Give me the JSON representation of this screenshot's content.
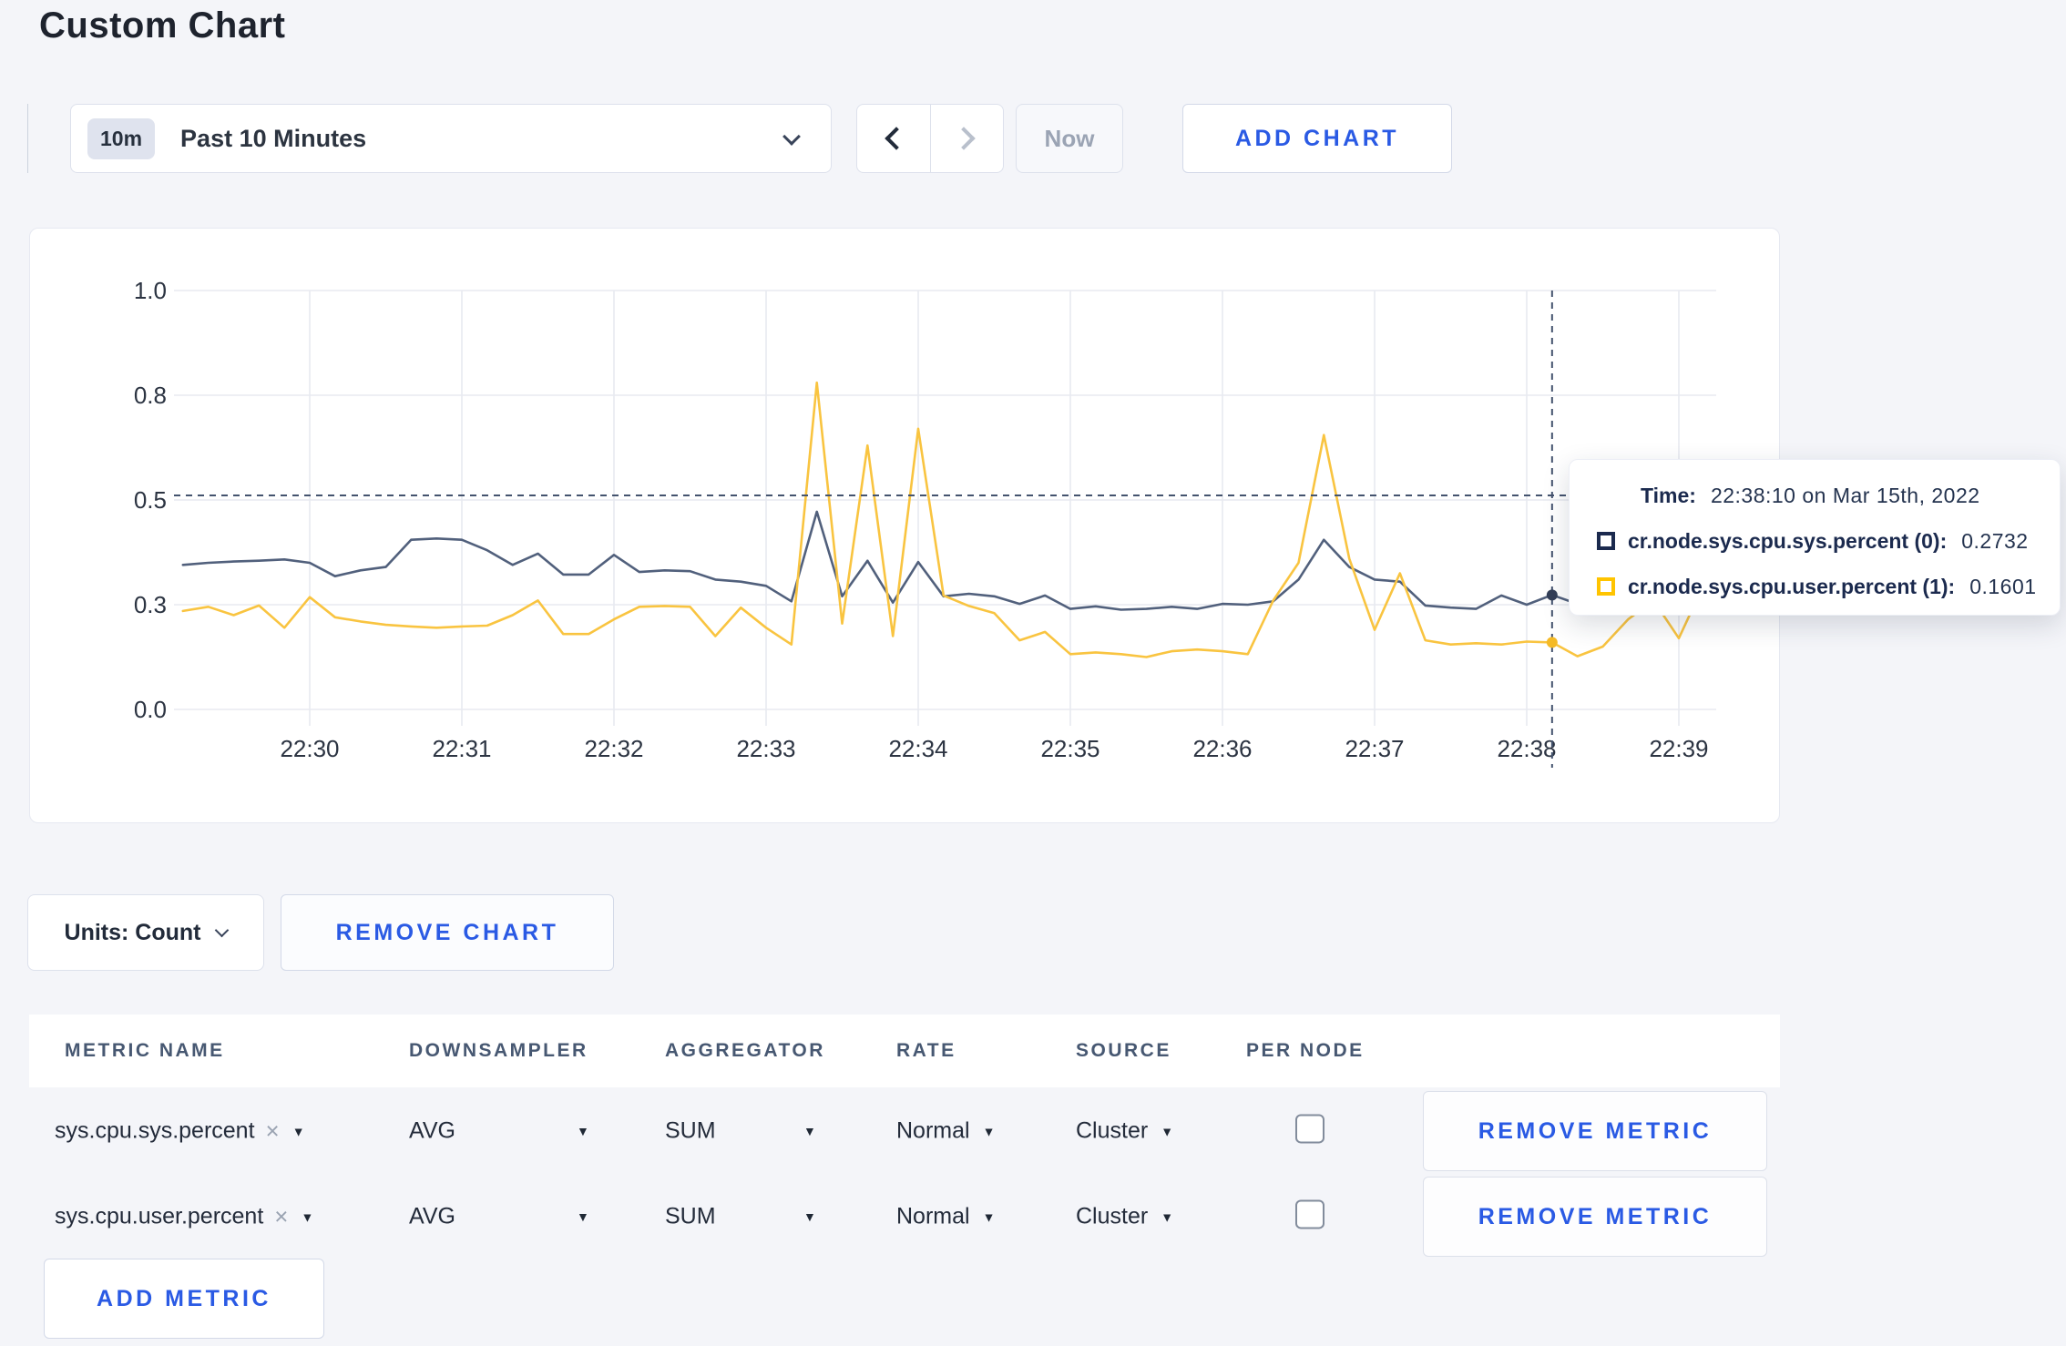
{
  "page": {
    "title": "Custom Chart"
  },
  "toolbar": {
    "timescale_badge": "10m",
    "timescale_label": "Past 10 Minutes",
    "now_label": "Now",
    "add_chart_label": "ADD CHART"
  },
  "chart_data": {
    "type": "line",
    "title": "",
    "xlabel": "",
    "ylabel": "",
    "ylim": [
      0,
      1
    ],
    "grid": true,
    "x_ticks": [
      "22:30",
      "22:31",
      "22:32",
      "22:33",
      "22:34",
      "22:35",
      "22:36",
      "22:37",
      "22:38",
      "22:39"
    ],
    "y_ticks": [
      {
        "label": "0.0",
        "value": 0
      },
      {
        "label": "0.3",
        "value": 0.25
      },
      {
        "label": "0.5",
        "value": 0.5
      },
      {
        "label": "0.8",
        "value": 0.75
      },
      {
        "label": "1.0",
        "value": 1.0
      }
    ],
    "x_start": "22:29:10",
    "x_step_seconds": 10,
    "series": [
      {
        "name": "cr.node.sys.cpu.sys.percent (0)",
        "color": "#51607c",
        "dot_color": "#333f58",
        "value_at_crosshair": 0.2732,
        "values": [
          0.345,
          0.35,
          0.353,
          0.355,
          0.358,
          0.35,
          0.318,
          0.332,
          0.34,
          0.405,
          0.408,
          0.405,
          0.38,
          0.345,
          0.372,
          0.322,
          0.322,
          0.369,
          0.328,
          0.332,
          0.33,
          0.31,
          0.305,
          0.295,
          0.258,
          0.472,
          0.27,
          0.355,
          0.255,
          0.352,
          0.27,
          0.276,
          0.27,
          0.252,
          0.272,
          0.24,
          0.246,
          0.238,
          0.24,
          0.245,
          0.24,
          0.252,
          0.25,
          0.258,
          0.31,
          0.405,
          0.34,
          0.31,
          0.305,
          0.248,
          0.243,
          0.24,
          0.272,
          0.25,
          0.2732,
          0.252,
          0.258,
          0.262,
          0.27,
          0.29,
          0.3
        ]
      },
      {
        "name": "cr.node.sys.cpu.user.percent (1)",
        "color": "#f9c440",
        "dot_color": "#f5ba25",
        "value_at_crosshair": 0.1601,
        "values": [
          0.235,
          0.245,
          0.225,
          0.248,
          0.195,
          0.268,
          0.22,
          0.21,
          0.202,
          0.198,
          0.195,
          0.198,
          0.2,
          0.225,
          0.26,
          0.18,
          0.18,
          0.215,
          0.245,
          0.247,
          0.245,
          0.175,
          0.243,
          0.195,
          0.155,
          0.78,
          0.205,
          0.63,
          0.175,
          0.67,
          0.272,
          0.247,
          0.23,
          0.165,
          0.185,
          0.132,
          0.136,
          0.132,
          0.125,
          0.139,
          0.143,
          0.139,
          0.132,
          0.26,
          0.35,
          0.655,
          0.36,
          0.19,
          0.325,
          0.165,
          0.155,
          0.158,
          0.155,
          0.162,
          0.1601,
          0.127,
          0.15,
          0.215,
          0.26,
          0.17,
          0.3
        ]
      }
    ],
    "crosshair": {
      "time": "22:38:10",
      "hover_value": 0.511
    }
  },
  "tooltip": {
    "time_label": "Time:",
    "time_value": "22:38:10 on Mar 15th, 2022",
    "rows": [
      {
        "label": "cr.node.sys.cpu.sys.percent (0):",
        "value": "0.2732",
        "swatch_color": "#1b2a4e"
      },
      {
        "label": "cr.node.sys.cpu.user.percent (1):",
        "value": "0.1601",
        "swatch_color": "#ffc400"
      }
    ]
  },
  "chart_controls": {
    "units_label": "Units: Count",
    "remove_chart_label": "REMOVE CHART"
  },
  "metrics_table": {
    "headers": [
      "METRIC NAME",
      "DOWNSAMPLER",
      "AGGREGATOR",
      "RATE",
      "SOURCE",
      "PER NODE"
    ],
    "rows": [
      {
        "metric": "sys.cpu.sys.percent",
        "downsampler": "AVG",
        "aggregator": "SUM",
        "rate": "Normal",
        "source": "Cluster",
        "per_node_checked": false,
        "remove_label": "REMOVE METRIC"
      },
      {
        "metric": "sys.cpu.user.percent",
        "downsampler": "AVG",
        "aggregator": "SUM",
        "rate": "Normal",
        "source": "Cluster",
        "per_node_checked": false,
        "remove_label": "REMOVE METRIC"
      }
    ],
    "add_metric_label": "ADD METRIC"
  }
}
